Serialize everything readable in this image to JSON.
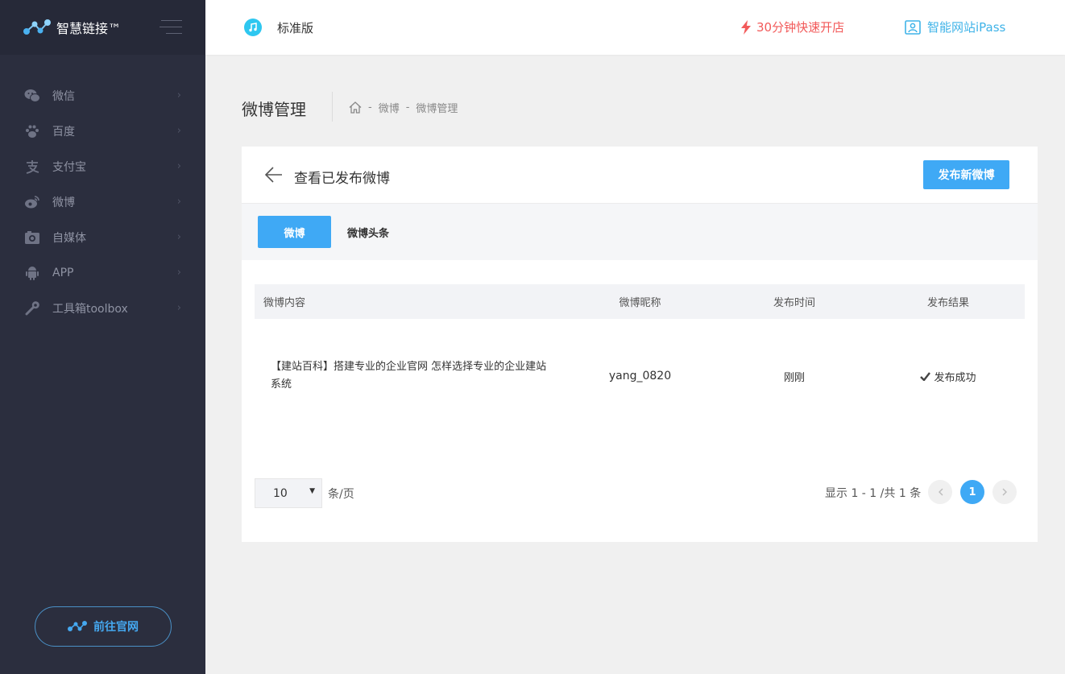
{
  "sidebar": {
    "brand": "智慧链接™",
    "items": [
      {
        "label": "微信",
        "icon": "wechat-icon"
      },
      {
        "label": "百度",
        "icon": "paw-icon"
      },
      {
        "label": "支付宝",
        "icon": "alipay-icon"
      },
      {
        "label": "微博",
        "icon": "weibo-icon"
      },
      {
        "label": "自媒体",
        "icon": "camera-icon"
      },
      {
        "label": "APP",
        "icon": "android-icon"
      },
      {
        "label": "工具箱toolbox",
        "icon": "wrench-icon"
      }
    ],
    "goto_label": "前往官网"
  },
  "header": {
    "edition": "标准版",
    "quick_open": "30分钟快速开店",
    "ipass": "智能网站iPass"
  },
  "page": {
    "title": "微博管理",
    "breadcrumb": [
      "微博",
      "微博管理"
    ]
  },
  "card": {
    "title": "查看已发布微博",
    "publish_label": "发布新微博",
    "tabs": [
      "微博",
      "微博头条"
    ]
  },
  "table": {
    "headers": [
      "微博内容",
      "微博昵称",
      "发布时间",
      "发布结果"
    ],
    "rows": [
      {
        "content": "【建站百科】搭建专业的企业官网 怎样选择专业的企业建站系统",
        "nickname": "yang_0820",
        "time": "刚刚",
        "result": "发布成功"
      }
    ]
  },
  "pagination": {
    "page_size": "10",
    "per_page_label": "条/页",
    "info": "显示 1 - 1 /共 1 条",
    "current": "1"
  },
  "colors": {
    "sidebar_bg": "#2b2e3e",
    "accent": "#3fa9f5",
    "alert": "#f25a5a"
  }
}
